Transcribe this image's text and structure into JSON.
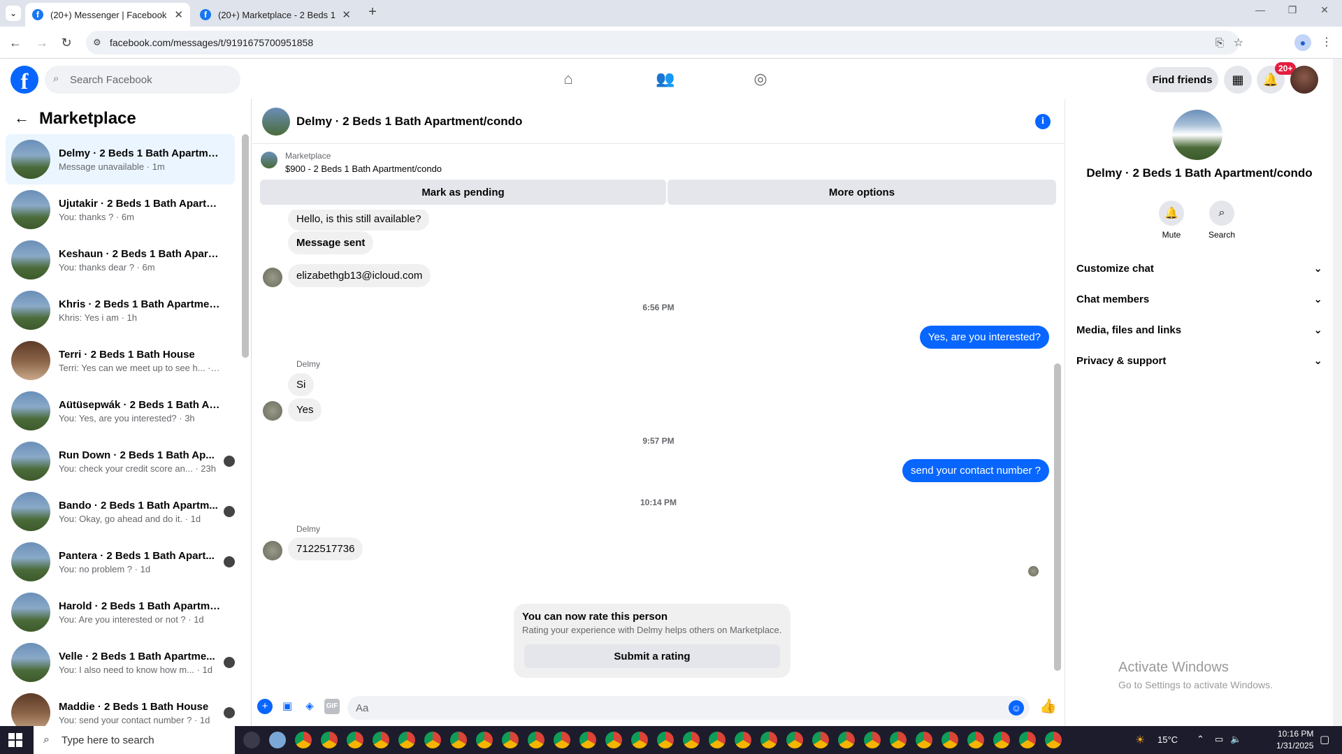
{
  "browser": {
    "tabs": [
      {
        "title": "(20+) Messenger | Facebook",
        "active": true
      },
      {
        "title": "(20+) Marketplace - 2 Beds 1 B",
        "active": false
      }
    ],
    "url": "facebook.com/messages/t/9191675700951858"
  },
  "header": {
    "search_placeholder": "Search Facebook",
    "find_friends_label": "Find friends",
    "notification_badge": "20+"
  },
  "sidebar": {
    "title": "Marketplace",
    "conversations": [
      {
        "name": "Delmy · 2 Beds 1 Bath Apartmen...",
        "snippet": "Message unavailable · 1m",
        "selected": true,
        "thumb": "house-exterior"
      },
      {
        "name": "Ujutakir · 2 Beds 1 Bath Apartm...",
        "snippet": "You: thanks ? · 6m",
        "thumb": "house-exterior"
      },
      {
        "name": "Keshaun · 2 Beds 1 Bath Apartm...",
        "snippet": "You: thanks dear ? · 6m",
        "thumb": "house-exterior"
      },
      {
        "name": "Khris · 2 Beds 1 Bath Apartment...",
        "snippet": "Khris: Yes i am · 1h",
        "thumb": "house-exterior"
      },
      {
        "name": "Terri · 2 Beds 1 Bath House",
        "snippet": "Terri: Yes can we meet up to see h... · 1h",
        "thumb": "house-interior"
      },
      {
        "name": "Aütüsepwák · 2 Beds 1 Bath Apa...",
        "snippet": "You: Yes, are you interested? · 3h",
        "thumb": "house-exterior"
      },
      {
        "name": "Run Down · 2 Beds 1 Bath Ap...",
        "snippet": "You: check your credit score an... · 23h",
        "thumb": "house-exterior",
        "seen_avatar": true
      },
      {
        "name": "Bando · 2 Beds 1 Bath Apartm...",
        "snippet": "You: Okay, go ahead and do it. · 1d",
        "thumb": "house-exterior",
        "seen_avatar": true
      },
      {
        "name": "Pantera · 2 Beds 1 Bath Apart...",
        "snippet": "You: no problem ? · 1d",
        "thumb": "house-exterior",
        "seen_avatar": true
      },
      {
        "name": "Harold · 2 Beds 1 Bath Apartme...",
        "snippet": "You: Are you interested or not ? · 1d",
        "thumb": "house-exterior"
      },
      {
        "name": "Velle · 2 Beds 1 Bath Apartme...",
        "snippet": "You: I also need to know how m... · 1d",
        "thumb": "house-exterior",
        "seen_avatar": true
      },
      {
        "name": "Maddie · 2 Beds 1 Bath House",
        "snippet": "You: send your contact number ? · 1d",
        "thumb": "house-interior",
        "seen_avatar": true
      }
    ]
  },
  "chat": {
    "title": "Delmy · 2 Beds 1 Bath Apartment/condo",
    "listing_label": "Marketplace",
    "listing_title": "$900 - 2 Beds 1 Bath Apartment/condo",
    "mark_pending_label": "Mark as pending",
    "more_options_label": "More options",
    "messages": [
      {
        "type": "in",
        "text": "Hello, is this still available?"
      },
      {
        "type": "in",
        "text": "Message sent"
      },
      {
        "type": "in",
        "text": "elizabethgb13@icloud.com"
      },
      {
        "type": "stamp",
        "text": "6:56 PM"
      },
      {
        "type": "out",
        "text": "Yes, are you interested?"
      },
      {
        "type": "sender",
        "text": "Delmy"
      },
      {
        "type": "in",
        "text": "Si"
      },
      {
        "type": "in",
        "text": "Yes"
      },
      {
        "type": "stamp",
        "text": "9:57 PM"
      },
      {
        "type": "out",
        "text": "send your contact number ?"
      },
      {
        "type": "stamp",
        "text": "10:14 PM"
      },
      {
        "type": "sender",
        "text": "Delmy"
      },
      {
        "type": "in",
        "text": "7122517736"
      }
    ],
    "rating": {
      "title": "You can now rate this person",
      "subtitle": "Rating your experience with Delmy helps others on Marketplace.",
      "button": "Submit a rating"
    },
    "composer_placeholder": "Aa"
  },
  "details": {
    "name": "Delmy · 2 Beds 1 Bath Apartment/condo",
    "actions": [
      {
        "label": "Mute",
        "icon": "bell-icon"
      },
      {
        "label": "Search",
        "icon": "search-icon"
      }
    ],
    "sections": [
      "Customize chat",
      "Chat members",
      "Media, files and links",
      "Privacy & support"
    ],
    "watermark_title": "Activate Windows",
    "watermark_sub": "Go to Settings to activate Windows."
  },
  "taskbar": {
    "search_placeholder": "Type here to search",
    "temperature": "15°C",
    "time": "10:16 PM",
    "date": "1/31/2025"
  },
  "colors": {
    "fb_blue": "#0866ff",
    "selected_bg": "#ebf5ff",
    "bubble_in": "#f0f0f0"
  }
}
